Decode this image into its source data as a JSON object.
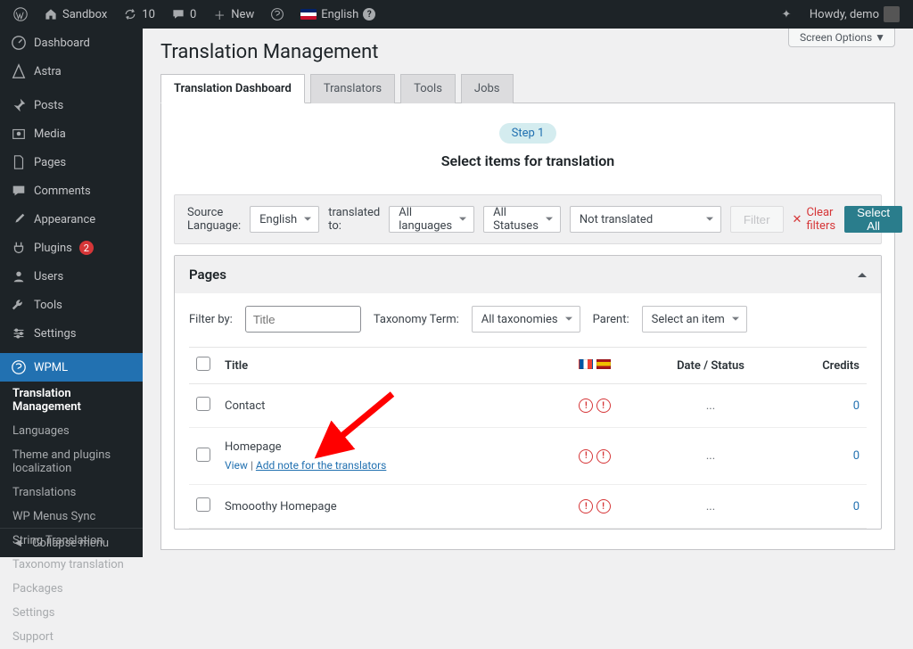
{
  "adminbar": {
    "site": "Sandbox",
    "updates": "10",
    "comments": "0",
    "new": "New",
    "language": "English",
    "howdy": "Howdy, demo"
  },
  "sidebar": {
    "items": [
      {
        "label": "Dashboard",
        "icon": "dashboard"
      },
      {
        "label": "Astra",
        "icon": "astra"
      },
      {
        "label": "Posts",
        "icon": "pin"
      },
      {
        "label": "Media",
        "icon": "media"
      },
      {
        "label": "Pages",
        "icon": "page"
      },
      {
        "label": "Comments",
        "icon": "comment"
      },
      {
        "label": "Appearance",
        "icon": "brush"
      },
      {
        "label": "Plugins",
        "icon": "plugin",
        "count": "2"
      },
      {
        "label": "Users",
        "icon": "user"
      },
      {
        "label": "Tools",
        "icon": "tools"
      },
      {
        "label": "Settings",
        "icon": "settings"
      },
      {
        "label": "WPML",
        "icon": "wpml",
        "current": true
      }
    ],
    "wpml_sub": [
      "Translation Management",
      "Languages",
      "Theme and plugins localization",
      "Translations",
      "WP Menus Sync",
      "String Translation",
      "Taxonomy translation",
      "Packages",
      "Settings",
      "Support"
    ],
    "collapse": "Collapse menu"
  },
  "screen_options": "Screen Options",
  "page_title": "Translation Management",
  "tabs": [
    "Translation Dashboard",
    "Translators",
    "Tools",
    "Jobs"
  ],
  "step": {
    "badge": "Step 1",
    "title": "Select items for translation"
  },
  "filters": {
    "source_label": "Source Language:",
    "source_value": "English",
    "translated_to_label": "translated to:",
    "translated_to_value": "All languages",
    "status_value": "All Statuses",
    "translated_value": "Not translated",
    "filter_btn": "Filter",
    "clear": "Clear filters",
    "select_all": "Select All"
  },
  "section": {
    "title": "Pages",
    "filter_by": "Filter by:",
    "title_input": "Title",
    "tax_label": "Taxonomy Term:",
    "tax_value": "All taxonomies",
    "parent_label": "Parent:",
    "parent_value": "Select an item"
  },
  "table": {
    "cols": {
      "title": "Title",
      "date": "Date / Status",
      "credits": "Credits"
    },
    "rows": [
      {
        "title": "Contact",
        "date": "...",
        "credits": "0"
      },
      {
        "title": "Homepage",
        "date": "...",
        "credits": "0",
        "hover": true,
        "view": "View",
        "note": "Add note for the translators"
      },
      {
        "title": "Smooothy Homepage",
        "date": "...",
        "credits": "0"
      }
    ]
  }
}
